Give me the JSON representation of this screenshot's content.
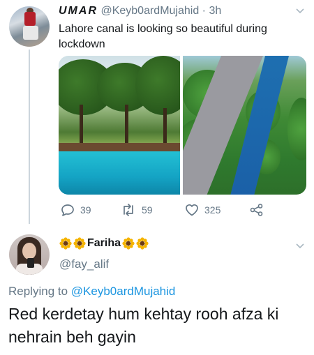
{
  "tweet": {
    "display_name": "UMAR",
    "handle": "@Keyb0ardMujahid",
    "separator": "·",
    "time": "3h",
    "text": "Lahore canal is looking so beautiful during lockdown",
    "actions": {
      "reply_count": "39",
      "retweet_count": "59",
      "like_count": "325"
    },
    "icons": [
      "chevron-down-icon",
      "reply-icon",
      "retweet-icon",
      "like-icon",
      "share-icon"
    ]
  },
  "reply": {
    "display_name": "Fariha",
    "handle": "@fay_alif",
    "replying_prefix": "Replying to",
    "replying_to": "@Keyb0ardMujahid",
    "text": "Red kerdetay hum kehtay rooh afza ki nehrain beh gayin",
    "name_emoji": "sunflower"
  },
  "colors": {
    "secondary_text": "#657786",
    "link": "#1b95e0",
    "thread_line": "#ccd6dd"
  }
}
